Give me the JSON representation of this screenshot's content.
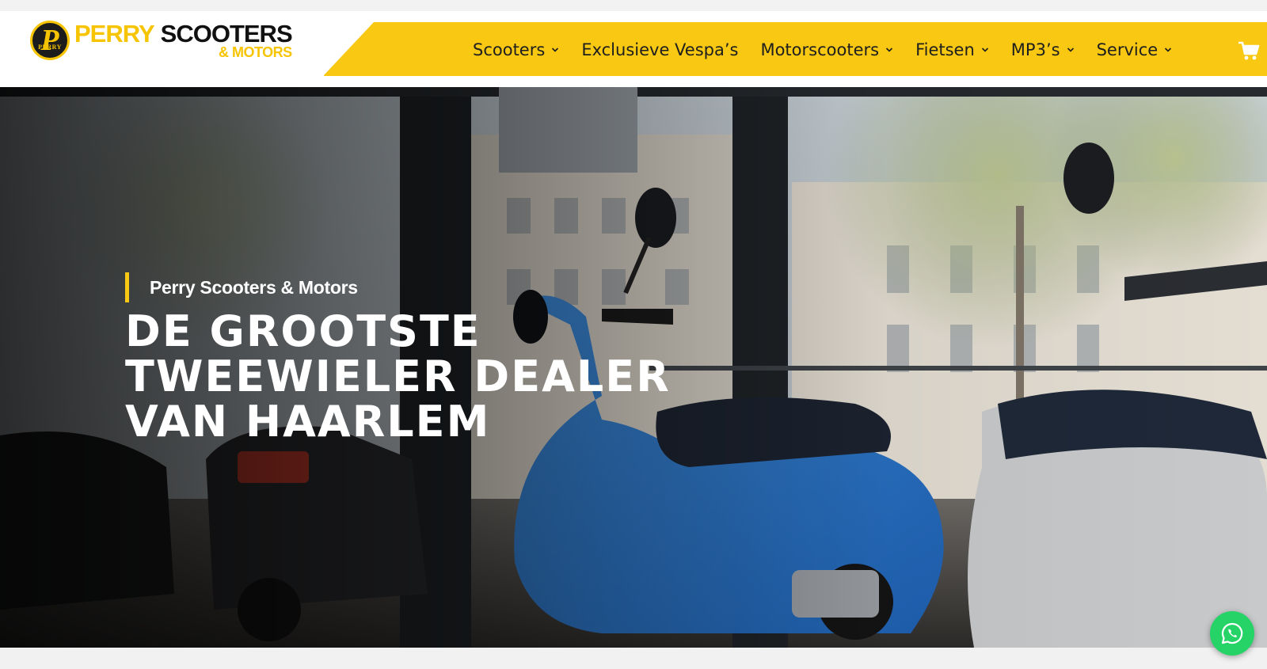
{
  "brand": {
    "badge_letter": "P",
    "badge_small": "PERRY",
    "name_part1": "PERRY",
    "name_part2": "SCOOTERS",
    "tagline": "& MOTORS",
    "colors": {
      "yellow": "#f8c813",
      "dark": "#111111"
    }
  },
  "nav": {
    "items": [
      {
        "label": "Scooters",
        "has_dropdown": true
      },
      {
        "label": "Exclusieve Vespa’s",
        "has_dropdown": false
      },
      {
        "label": "Motorscooters",
        "has_dropdown": true
      },
      {
        "label": "Fietsen",
        "has_dropdown": true
      },
      {
        "label": "MP3’s",
        "has_dropdown": true
      },
      {
        "label": "Service",
        "has_dropdown": true
      }
    ],
    "cart_icon": "cart-icon"
  },
  "hero": {
    "eyebrow": "Perry Scooters & Motors",
    "title_lines": [
      "DE GROOTSTE",
      "TWEEWIELER DEALER",
      "VAN HAARLEM"
    ]
  },
  "whatsapp": {
    "icon": "whatsapp-icon",
    "color": "#25d366"
  }
}
